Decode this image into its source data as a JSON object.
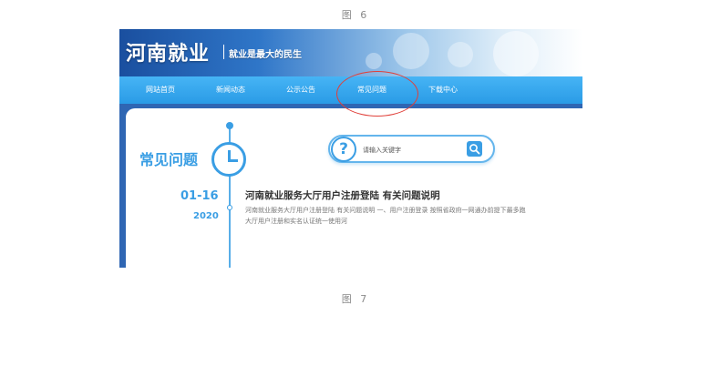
{
  "captions": {
    "top": "图 6",
    "bottom": "图 7"
  },
  "site": {
    "logo_title": "河南就业",
    "slogan": "就业是最大的民生"
  },
  "nav": {
    "items": [
      "网站首页",
      "新闻动态",
      "公示公告",
      "常见问题",
      "下载中心"
    ]
  },
  "section": {
    "title": "常见问题"
  },
  "search": {
    "placeholder": "请输入关键字",
    "q_glyph": "?"
  },
  "news": {
    "date_day": "01-16",
    "date_year": "2020",
    "title": "河南就业服务大厅用户注册登陆 有关问题说明",
    "summary_line1": "河南就业服务大厅用户注册登陆 有关问题说明 一、用户注册登录 按照省政府一网通办前提下最多跑",
    "summary_line2": "大厅用户注册和实名认证统一使用河"
  },
  "colors": {
    "accent": "#3a9ee4",
    "nav_bg": "#2a9be6",
    "annotation": "#e0403a"
  },
  "icons": {
    "clock": "clock-icon",
    "question": "question-icon",
    "search": "search-icon"
  }
}
